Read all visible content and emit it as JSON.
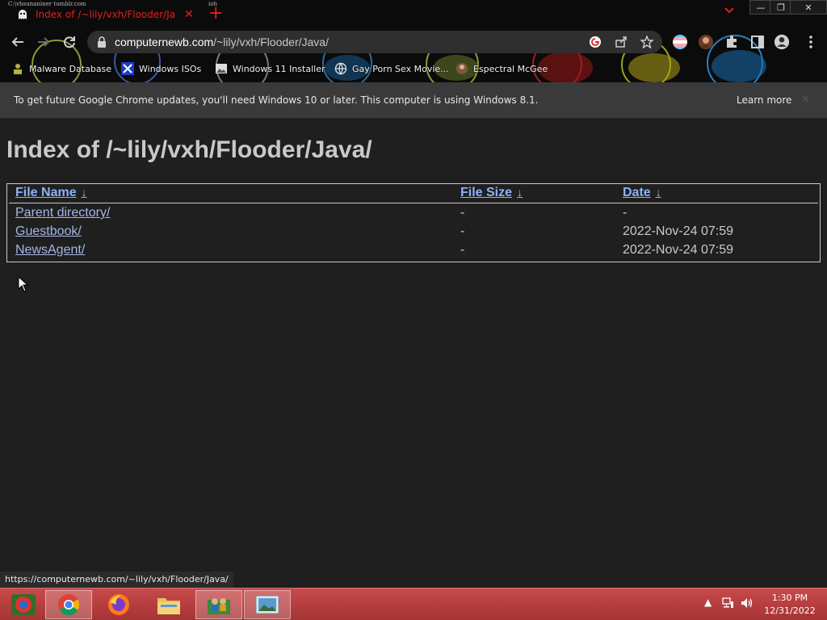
{
  "browser": {
    "tab": {
      "title": "Index of /~lily/vxh/Flooder/Java/",
      "close_glyph": "✕"
    },
    "tab_tiny_labels": [
      "C:\\vhsunaniner tumblr.com",
      "ioh"
    ],
    "new_tab_glyph": "+",
    "window_controls": {
      "minimize": "—",
      "restore": "❐",
      "close": "✕"
    },
    "url": {
      "host": "computernewb.com",
      "path": "/~lily/vxh/Flooder/Java/"
    },
    "bookmarks": [
      {
        "label": "Malware Database",
        "icon": "person-icon"
      },
      {
        "label": "Windows ISOs",
        "icon": "x-logo-icon"
      },
      {
        "label": "Windows 11 Installer",
        "icon": "image-icon"
      },
      {
        "label": "Gay Porn Sex Movie...",
        "icon": "globe-icon"
      },
      {
        "label": "Espectral McGee",
        "icon": "avatar-icon"
      }
    ],
    "colors": {
      "tab_accent": "#e02020",
      "omnibox_bg": "#2f2f2f"
    }
  },
  "infobar": {
    "message": "To get future Google Chrome updates, you'll need Windows 10 or later. This computer is using Windows 8.1.",
    "learn_more": "Learn more",
    "close_glyph": "✕"
  },
  "page": {
    "heading": "Index of /~lily/vxh/Flooder/Java/",
    "columns": [
      {
        "label": "File Name",
        "sort_glyph": "↓"
      },
      {
        "label": "File Size",
        "sort_glyph": "↓"
      },
      {
        "label": "Date",
        "sort_glyph": "↓"
      }
    ],
    "rows": [
      {
        "name": "Parent directory/",
        "size": "-",
        "date": "-"
      },
      {
        "name": "Guestbook/",
        "size": "-",
        "date": "2022-Nov-24 07:59"
      },
      {
        "name": "NewsAgent/",
        "size": "-",
        "date": "2022-Nov-24 07:59"
      }
    ]
  },
  "status_bar": {
    "url": "https://computernewb.com/~lily/vxh/Flooder/Java/"
  },
  "taskbar": {
    "apps": [
      "start-button",
      "chrome",
      "firefox",
      "file-explorer",
      "control-panel",
      "photos"
    ],
    "clock": {
      "time": "1:30 PM",
      "date": "12/31/2022"
    },
    "color": "#b83c3c"
  }
}
